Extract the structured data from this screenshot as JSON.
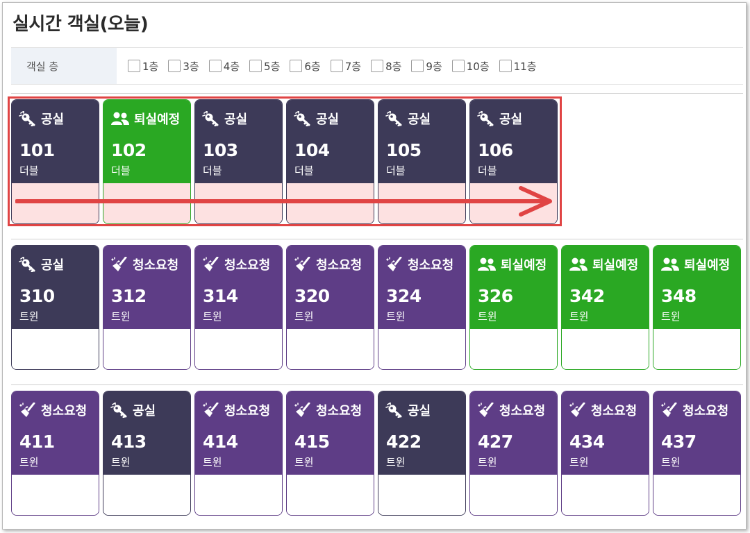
{
  "page": {
    "title": "실시간 객실(오늘)"
  },
  "filter": {
    "label": "객실 층",
    "floors": [
      "1층",
      "3층",
      "4층",
      "5층",
      "6층",
      "7층",
      "8층",
      "9층",
      "10층",
      "11층"
    ]
  },
  "colors": {
    "vacant": "#3d3a58",
    "checkout": "#2aa823",
    "clean": "#5e3d86",
    "highlight_border": "#e04444",
    "highlight_fill": "#fde1e1"
  },
  "rows": [
    {
      "rooms": [
        {
          "number": "101",
          "type": "더블",
          "status": "공실",
          "kind": "vacant",
          "icon": "key-icon"
        },
        {
          "number": "102",
          "type": "더블",
          "status": "퇴실예정",
          "kind": "checkout",
          "icon": "users-icon"
        },
        {
          "number": "103",
          "type": "더블",
          "status": "공실",
          "kind": "vacant",
          "icon": "key-icon"
        },
        {
          "number": "104",
          "type": "더블",
          "status": "공실",
          "kind": "vacant",
          "icon": "key-icon"
        },
        {
          "number": "105",
          "type": "더블",
          "status": "공실",
          "kind": "vacant",
          "icon": "key-icon"
        },
        {
          "number": "106",
          "type": "더블",
          "status": "공실",
          "kind": "vacant",
          "icon": "key-icon"
        }
      ]
    },
    {
      "rooms": [
        {
          "number": "310",
          "type": "트윈",
          "status": "공실",
          "kind": "vacant",
          "icon": "key-icon"
        },
        {
          "number": "312",
          "type": "트윈",
          "status": "청소요청",
          "kind": "clean",
          "icon": "broom-icon"
        },
        {
          "number": "314",
          "type": "트윈",
          "status": "청소요청",
          "kind": "clean",
          "icon": "broom-icon"
        },
        {
          "number": "320",
          "type": "트윈",
          "status": "청소요청",
          "kind": "clean",
          "icon": "broom-icon"
        },
        {
          "number": "324",
          "type": "트윈",
          "status": "청소요청",
          "kind": "clean",
          "icon": "broom-icon"
        },
        {
          "number": "326",
          "type": "트윈",
          "status": "퇴실예정",
          "kind": "checkout",
          "icon": "users-icon"
        },
        {
          "number": "342",
          "type": "트윈",
          "status": "퇴실예정",
          "kind": "checkout",
          "icon": "users-icon"
        },
        {
          "number": "348",
          "type": "트윈",
          "status": "퇴실예정",
          "kind": "checkout",
          "icon": "users-icon"
        }
      ]
    },
    {
      "rooms": [
        {
          "number": "411",
          "type": "트윈",
          "status": "청소요청",
          "kind": "clean",
          "icon": "broom-icon"
        },
        {
          "number": "413",
          "type": "트윈",
          "status": "공실",
          "kind": "vacant",
          "icon": "key-icon"
        },
        {
          "number": "414",
          "type": "트윈",
          "status": "청소요청",
          "kind": "clean",
          "icon": "broom-icon"
        },
        {
          "number": "415",
          "type": "트윈",
          "status": "청소요청",
          "kind": "clean",
          "icon": "broom-icon"
        },
        {
          "number": "422",
          "type": "트윈",
          "status": "공실",
          "kind": "vacant",
          "icon": "key-icon"
        },
        {
          "number": "427",
          "type": "트윈",
          "status": "청소요청",
          "kind": "clean",
          "icon": "broom-icon"
        },
        {
          "number": "434",
          "type": "트윈",
          "status": "청소요청",
          "kind": "clean",
          "icon": "broom-icon"
        },
        {
          "number": "437",
          "type": "트윈",
          "status": "청소요청",
          "kind": "clean",
          "icon": "broom-icon"
        }
      ]
    }
  ]
}
